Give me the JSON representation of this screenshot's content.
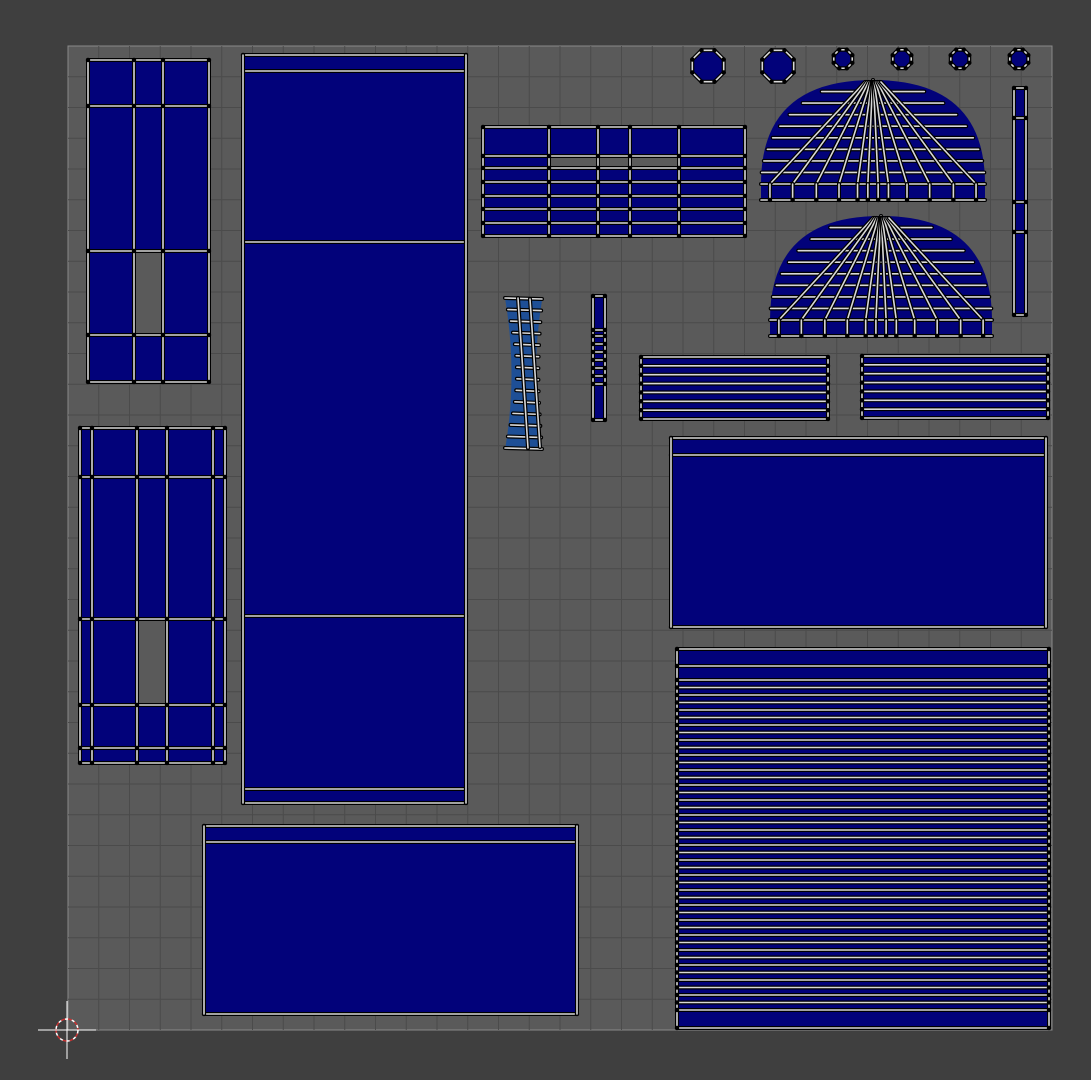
{
  "editor": {
    "view": "UV Editor",
    "grid": true,
    "colors": {
      "background": "#3f3f3f",
      "canvas": "#5a5a5a",
      "grid_line": "#4b4b4b",
      "canvas_border": "#8a8a8a",
      "island_fill": "#02027a",
      "island_fill_stretched": "#1e4f96",
      "edge_outer": "#000000",
      "edge_inner": "#d8d8d8",
      "vertex": "#000000",
      "cursor": "#c83232"
    },
    "cursor": {
      "name": "2d-cursor-icon"
    },
    "islands": [
      {
        "name": "panel-left-top",
        "shape": "grid"
      },
      {
        "name": "panel-left-bottom",
        "shape": "grid-flared"
      },
      {
        "name": "tall-column",
        "shape": "sections"
      },
      {
        "name": "bottom-rectangle",
        "shape": "rectangle-with-band"
      },
      {
        "name": "right-rectangle",
        "shape": "rectangle-with-band"
      },
      {
        "name": "right-striped-block",
        "shape": "stripes"
      },
      {
        "name": "middle-grid-block",
        "shape": "grid"
      },
      {
        "name": "small-stripe-left",
        "shape": "stripes"
      },
      {
        "name": "small-stripe-right",
        "shape": "stripes"
      },
      {
        "name": "dome-top",
        "shape": "dome"
      },
      {
        "name": "dome-bottom",
        "shape": "dome"
      },
      {
        "name": "curved-strip",
        "shape": "curved"
      },
      {
        "name": "thin-strip-middle",
        "shape": "strip"
      },
      {
        "name": "thin-strip-right",
        "shape": "strip"
      },
      {
        "name": "octagon-1",
        "shape": "octagon"
      },
      {
        "name": "octagon-2",
        "shape": "octagon"
      },
      {
        "name": "octagon-3",
        "shape": "octagon"
      },
      {
        "name": "octagon-4",
        "shape": "octagon"
      },
      {
        "name": "octagon-5",
        "shape": "octagon"
      },
      {
        "name": "octagon-6",
        "shape": "octagon"
      }
    ]
  }
}
